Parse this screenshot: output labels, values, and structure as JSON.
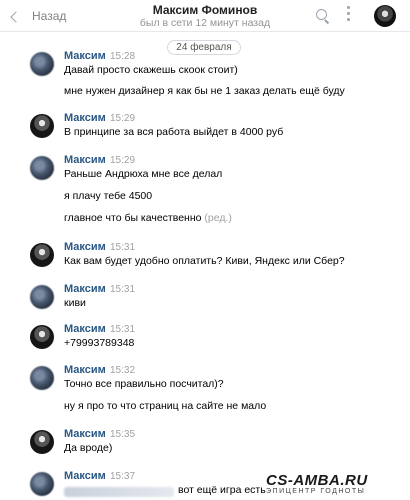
{
  "header": {
    "back_label": "Назад",
    "title": "Максим Фоминов",
    "subtitle": "был в сети 12 минут назад"
  },
  "date_divider": "24 февраля",
  "messages": [
    {
      "name": "Максим",
      "time": "15:28",
      "lines": [
        "Давай просто скажешь скоок стоит)",
        "мне нужен дизайнер я как бы не 1 заказ делать ещё буду"
      ]
    },
    {
      "name": "Максим",
      "time": "15:29",
      "lines": [
        "В принципе за вся работа выйдет в 4000 руб"
      ]
    },
    {
      "name": "Максим",
      "time": "15:29",
      "lines": [
        "Раньше Андрюха мне все делал",
        "я плачу тебе 4500",
        "главное что бы качественно"
      ],
      "edited": "(ред.)"
    },
    {
      "name": "Максим",
      "time": "15:31",
      "lines": [
        "Как вам будет удобно оплатить? Киви, Яндекс или Сбер?"
      ]
    },
    {
      "name": "Максим",
      "time": "15:31",
      "lines": [
        "киви"
      ]
    },
    {
      "name": "Максим",
      "time": "15:31",
      "lines": [
        "+79993789348"
      ]
    },
    {
      "name": "Максим",
      "time": "15:32",
      "lines": [
        "Точно все правильно посчитал)?",
        "ну я про то что страниц на сайте не мало"
      ]
    },
    {
      "name": "Максим",
      "time": "15:35",
      "lines": [
        "Да вроде)"
      ]
    },
    {
      "name": "Максим",
      "time": "15:37",
      "lines": [
        "вот ещё игра есть"
      ]
    }
  ],
  "watermark": {
    "logo": "CS-AMBA.RU",
    "tagline": "ЭПИЦЕНТР ГОДНОТЫ"
  },
  "icons": [
    "chevron-left-icon",
    "search-icon",
    "more-icon"
  ]
}
